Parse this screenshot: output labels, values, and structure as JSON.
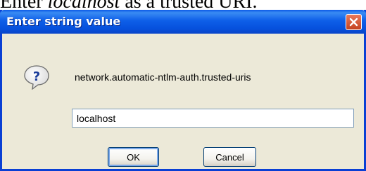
{
  "caption": {
    "prefix": "Enter ",
    "emphasis": "localhost",
    "suffix": " as a trusted URI."
  },
  "dialog": {
    "title": "Enter string value",
    "close_icon": "close-icon",
    "question_icon": "question-icon",
    "pref_name": "network.automatic-ntlm-auth.trusted-uris",
    "input_value": "localhost",
    "ok_label": "OK",
    "cancel_label": "Cancel"
  },
  "colors": {
    "titlebar": "#0a58e6",
    "dialog_bg": "#ece9d8",
    "close_button": "#d9542f",
    "input_border": "#7f9db9"
  }
}
